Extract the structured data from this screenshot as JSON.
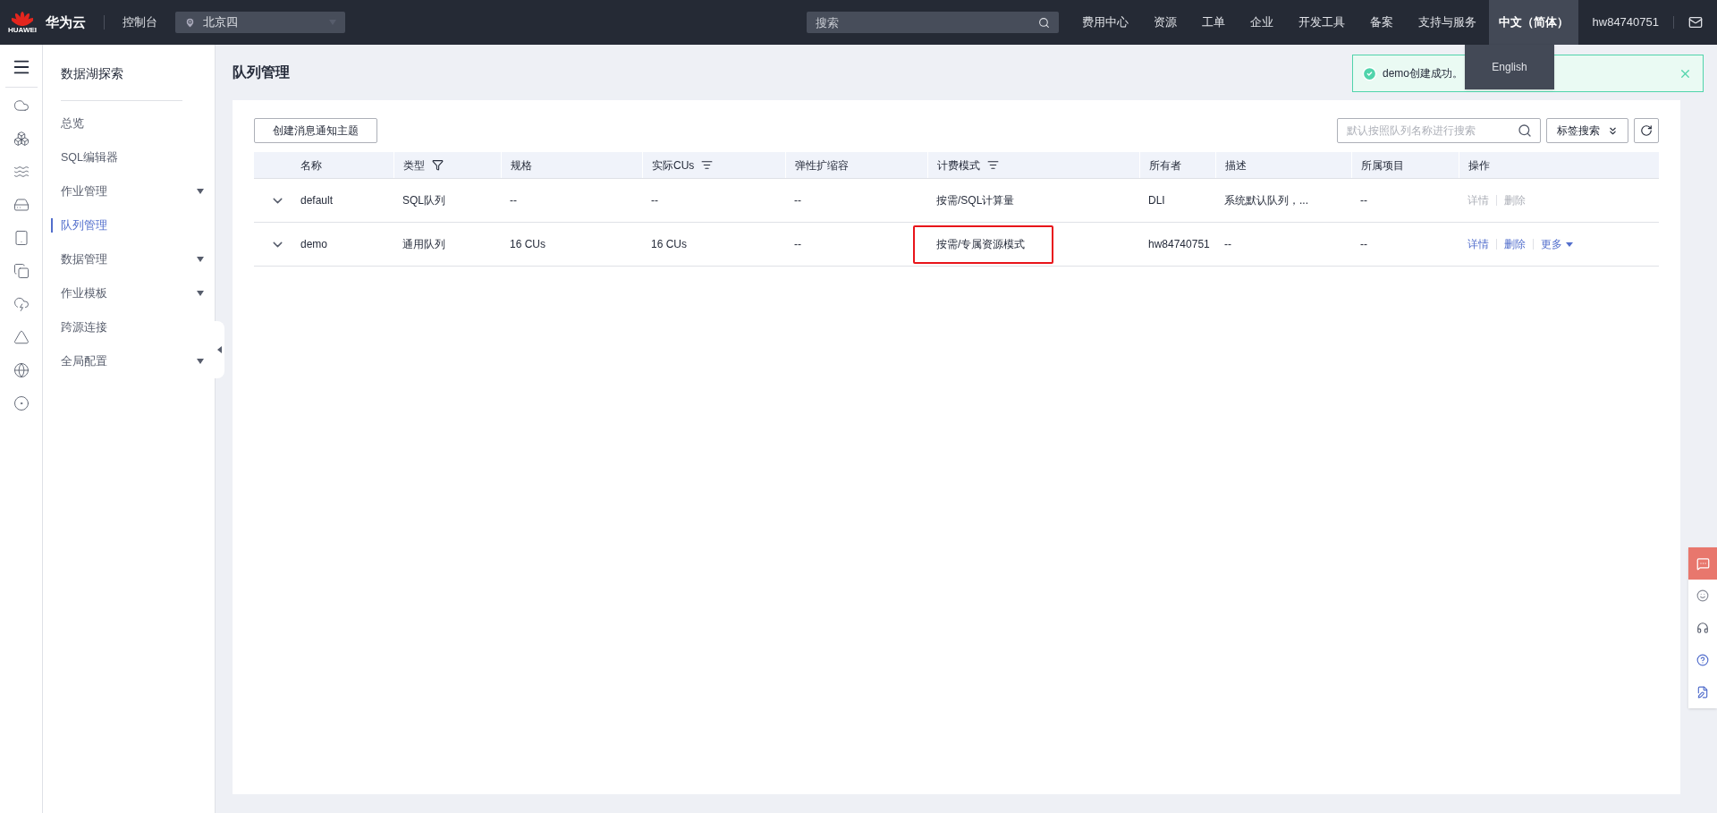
{
  "topbar": {
    "brand": "华为云",
    "logo_text": "HUAWEI",
    "console": "控制台",
    "region": "北京四",
    "search": {
      "placeholder": "搜索"
    },
    "nav": [
      {
        "label": "费用中心",
        "selected": false
      },
      {
        "label": "资源",
        "selected": false
      },
      {
        "label": "工单",
        "selected": false
      },
      {
        "label": "企业",
        "selected": false
      },
      {
        "label": "开发工具",
        "selected": false
      },
      {
        "label": "备案",
        "selected": false
      },
      {
        "label": "支持与服务",
        "selected": false
      },
      {
        "label": "中文（简体）",
        "selected": true
      }
    ],
    "user": "hw84740751"
  },
  "language_menu": {
    "items": [
      "English"
    ]
  },
  "toast": {
    "message": "demo创建成功。"
  },
  "sidebar": {
    "title": "数据湖探索",
    "items": [
      {
        "label": "总览",
        "selected": false,
        "expandable": false
      },
      {
        "label": "SQL编辑器",
        "selected": false,
        "expandable": false
      },
      {
        "label": "作业管理",
        "selected": false,
        "expandable": true
      },
      {
        "label": "队列管理",
        "selected": true,
        "expandable": false
      },
      {
        "label": "数据管理",
        "selected": false,
        "expandable": true
      },
      {
        "label": "作业模板",
        "selected": false,
        "expandable": true
      },
      {
        "label": "跨源连接",
        "selected": false,
        "expandable": false
      },
      {
        "label": "全局配置",
        "selected": false,
        "expandable": true
      }
    ]
  },
  "page_title": "队列管理",
  "toolbar": {
    "create_button": "创建消息通知主题",
    "search": {
      "placeholder": "默认按照队列名称进行搜索"
    },
    "tag_search": "标签搜索"
  },
  "table": {
    "columns": [
      {
        "label": "名称",
        "kind": "plain"
      },
      {
        "label": "类型",
        "kind": "filter"
      },
      {
        "label": "规格",
        "kind": "plain"
      },
      {
        "label": "实际CUs",
        "kind": "sort"
      },
      {
        "label": "弹性扩缩容",
        "kind": "plain"
      },
      {
        "label": "计费模式",
        "kind": "sort"
      },
      {
        "label": "所有者",
        "kind": "plain"
      },
      {
        "label": "描述",
        "kind": "plain"
      },
      {
        "label": "所属项目",
        "kind": "plain"
      },
      {
        "label": "操作",
        "kind": "plain"
      }
    ],
    "rows": [
      {
        "cells": [
          "default",
          "SQL队列",
          "--",
          "--",
          "--",
          "按需/SQL计算量",
          "DLI",
          "系统默认队列，...",
          "--"
        ],
        "billing_highlighted": false,
        "actions": [
          {
            "label": "详情",
            "disabled": true,
            "kind": "link"
          },
          {
            "label": "删除",
            "disabled": true,
            "kind": "link"
          }
        ]
      },
      {
        "cells": [
          "demo",
          "通用队列",
          "16 CUs",
          "16 CUs",
          "--",
          "按需/专属资源模式",
          "hw84740751",
          "--",
          "--"
        ],
        "billing_highlighted": true,
        "actions": [
          {
            "label": "详情",
            "disabled": false,
            "kind": "link"
          },
          {
            "label": "删除",
            "disabled": false,
            "kind": "link"
          },
          {
            "label": "更多",
            "disabled": false,
            "kind": "dropdown"
          }
        ]
      }
    ]
  }
}
